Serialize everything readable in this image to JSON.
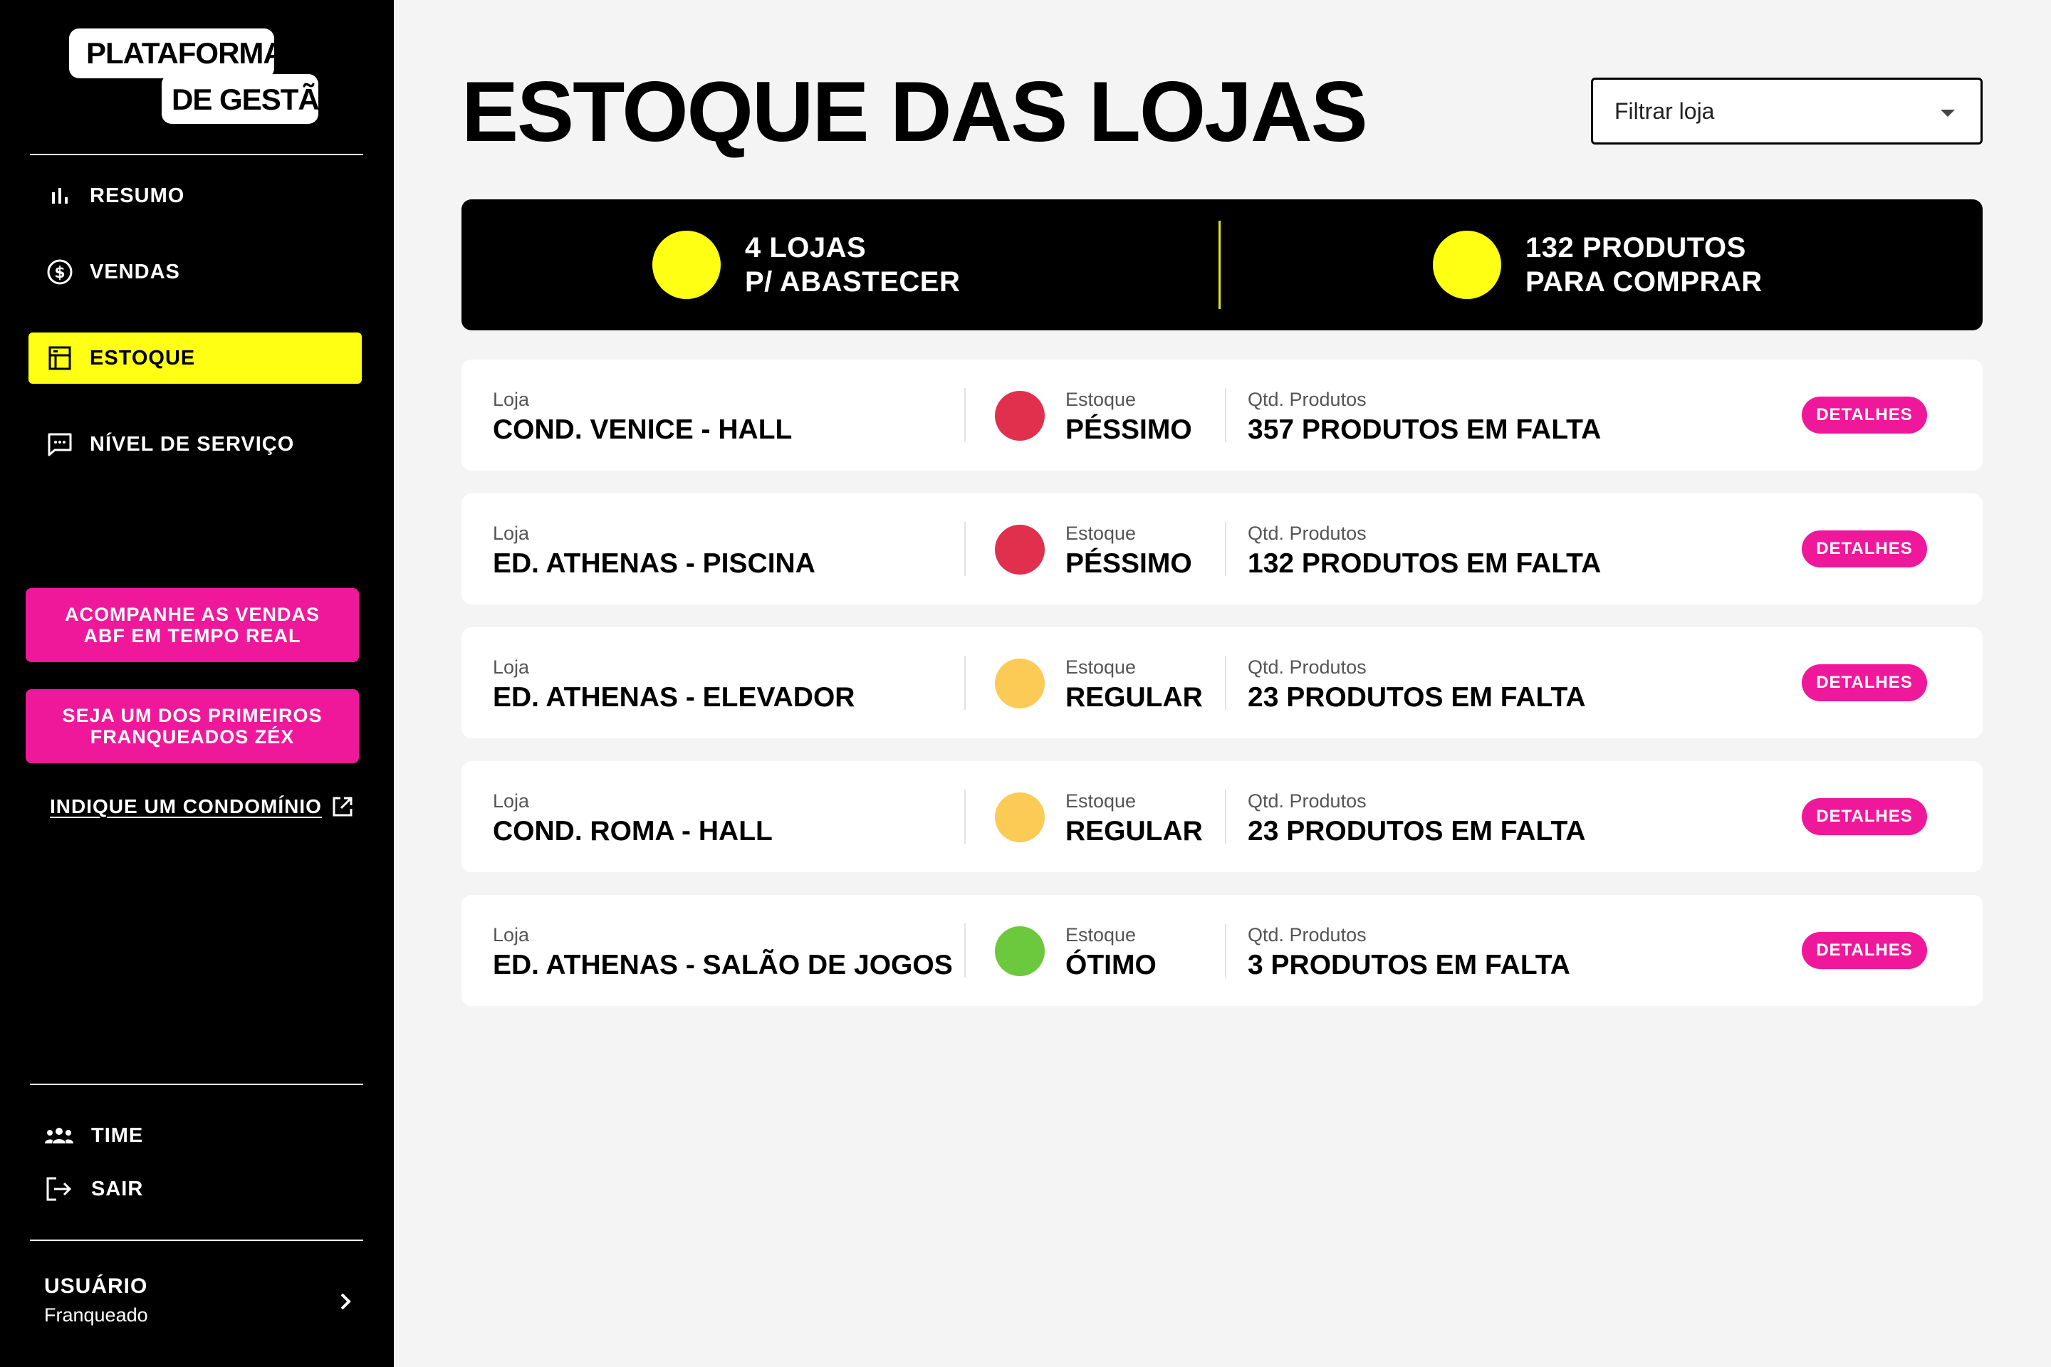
{
  "logo": {
    "line1": "PLATAFORMA",
    "line2": "DE GESTÃO"
  },
  "sidebar": {
    "nav": [
      {
        "label": "RESUMO",
        "icon": "bar-chart-icon",
        "active": false
      },
      {
        "label": "VENDAS",
        "icon": "dollar-circle-icon",
        "active": false
      },
      {
        "label": "ESTOQUE",
        "icon": "inventory-icon",
        "active": true
      },
      {
        "label": "NÍVEL DE SERVIÇO",
        "icon": "chat-icon",
        "active": false
      }
    ],
    "promo": [
      {
        "line1": "ACOMPANHE AS VENDAS",
        "line2": "ABF EM TEMPO REAL"
      },
      {
        "line1": "SEJA UM DOS PRIMEIROS",
        "line2": "FRANQUEADOS ZÉX"
      }
    ],
    "indique_label": "INDIQUE UM CONDOMÍNIO",
    "bottom": [
      {
        "label": "TIME",
        "icon": "team-icon"
      },
      {
        "label": "SAIR",
        "icon": "logout-icon"
      }
    ],
    "user": {
      "name": "USUÁRIO",
      "role": "Franqueado"
    }
  },
  "header": {
    "title": "ESTOQUE DAS LOJAS",
    "filter_placeholder": "Filtrar loja"
  },
  "summary": [
    {
      "line1": "4 LOJAS",
      "line2": "P/ ABASTECER"
    },
    {
      "line1": "132 PRODUTOS",
      "line2": "PARA COMPRAR"
    }
  ],
  "colors": {
    "accent_yellow": "#ffff14",
    "accent_pink": "#f0189a",
    "status_pessimo": "#e0304e",
    "status_regular": "#fccb55",
    "status_otimo": "#6cc83c"
  },
  "stores": {
    "caption_loja": "Loja",
    "caption_estoque": "Estoque",
    "caption_qtd": "Qtd. Produtos",
    "details_label": "DETALHES",
    "rows": [
      {
        "loja": "COND. VENICE - HALL",
        "estoque": "PÉSSIMO",
        "status_color": "#e0304e",
        "qtd": "357 PRODUTOS EM FALTA"
      },
      {
        "loja": "ED. ATHENAS - PISCINA",
        "estoque": "PÉSSIMO",
        "status_color": "#e0304e",
        "qtd": "132 PRODUTOS EM FALTA"
      },
      {
        "loja": "ED. ATHENAS - ELEVADOR",
        "estoque": "REGULAR",
        "status_color": "#fccb55",
        "qtd": "23 PRODUTOS EM FALTA"
      },
      {
        "loja": "COND. ROMA - HALL",
        "estoque": "REGULAR",
        "status_color": "#fccb55",
        "qtd": "23 PRODUTOS EM FALTA"
      },
      {
        "loja": "ED. ATHENAS - SALÃO DE JOGOS",
        "estoque": "ÓTIMO",
        "status_color": "#6cc83c",
        "qtd": "3 PRODUTOS EM FALTA"
      }
    ]
  }
}
